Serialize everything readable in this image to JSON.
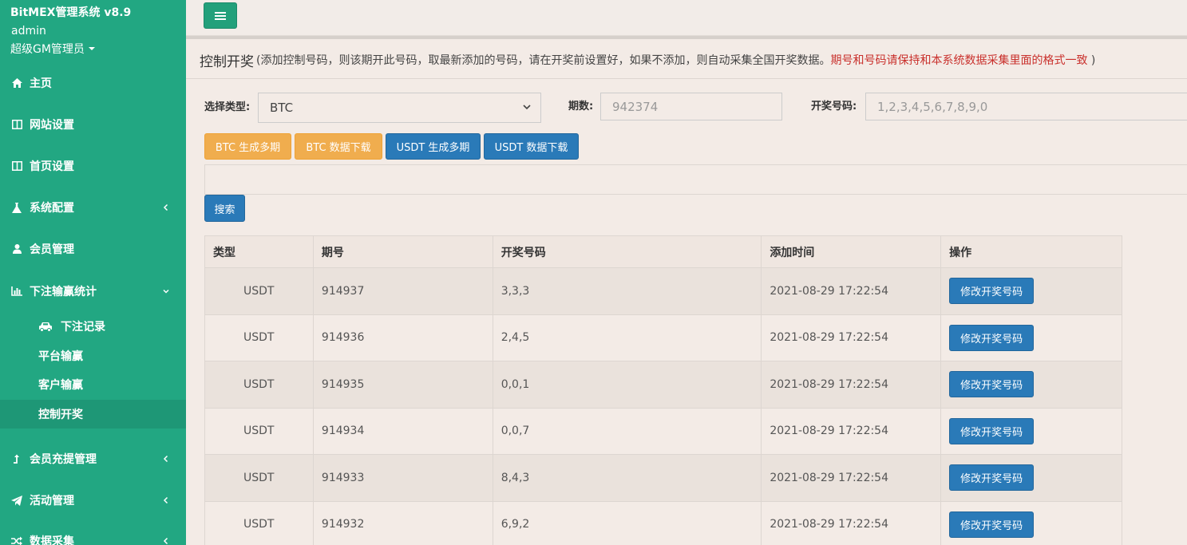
{
  "sidebar": {
    "brand": "BitMEX管理系统 v8.9",
    "user_name": "admin",
    "user_role": "超级GM管理员",
    "items": [
      {
        "label": "主页",
        "icon": "home-icon"
      },
      {
        "label": "网站设置",
        "icon": "columns-icon"
      },
      {
        "label": "首页设置",
        "icon": "columns-icon"
      },
      {
        "label": "系统配置",
        "icon": "flask-icon"
      },
      {
        "label": "会员管理",
        "icon": "user-icon"
      },
      {
        "label": "下注输赢统计",
        "icon": "bar-chart-icon"
      },
      {
        "label": "会员充提管理",
        "icon": "level-up-icon"
      },
      {
        "label": "活动管理",
        "icon": "paper-plane-icon"
      },
      {
        "label": "数据采集",
        "icon": "random-icon"
      }
    ],
    "sub_items": [
      {
        "label": "下注记录",
        "icon": "car-icon"
      },
      {
        "label": "平台输赢"
      },
      {
        "label": "客户输赢"
      },
      {
        "label": "控制开奖",
        "active": true
      }
    ]
  },
  "header": {
    "title": "控制开奖",
    "desc_prefix": "(添加控制号码，则该期开此号码，取最新添加的号码，请在开奖前设置好，如果不添加，则自动采集全国开奖数据。",
    "desc_warning": "期号和号码请保持和本系统数据采集里面的格式一致",
    "desc_suffix": " )"
  },
  "form": {
    "type_label": "选择类型:",
    "type_value": "BTC",
    "period_label": "期数:",
    "period_placeholder": "942374",
    "number_label": "开奖号码:",
    "number_placeholder": "1,2,3,4,5,6,7,8,9,0"
  },
  "buttons": {
    "btc_generate": "BTC 生成多期",
    "btc_download": "BTC 数据下载",
    "usdt_generate": "USDT 生成多期",
    "usdt_download": "USDT 数据下载",
    "search": "搜索"
  },
  "table": {
    "headers": [
      "类型",
      "期号",
      "开奖号码",
      "添加时间",
      "操作"
    ],
    "action_label": "修改开奖号码",
    "rows": [
      {
        "type": "USDT",
        "period": "914937",
        "number": "3,3,3",
        "time": "2021-08-29 17:22:54"
      },
      {
        "type": "USDT",
        "period": "914936",
        "number": "2,4,5",
        "time": "2021-08-29 17:22:54"
      },
      {
        "type": "USDT",
        "period": "914935",
        "number": "0,0,1",
        "time": "2021-08-29 17:22:54"
      },
      {
        "type": "USDT",
        "period": "914934",
        "number": "0,0,7",
        "time": "2021-08-29 17:22:54"
      },
      {
        "type": "USDT",
        "period": "914933",
        "number": "8,4,3",
        "time": "2021-08-29 17:22:54"
      },
      {
        "type": "USDT",
        "period": "914932",
        "number": "6,9,2",
        "time": "2021-08-29 17:22:54"
      }
    ]
  },
  "colors": {
    "sidebar_bg": "#22a782",
    "primary_blue": "#2a7ab8",
    "warning_orange": "#f0ad4e",
    "danger_text": "#c9302c"
  }
}
